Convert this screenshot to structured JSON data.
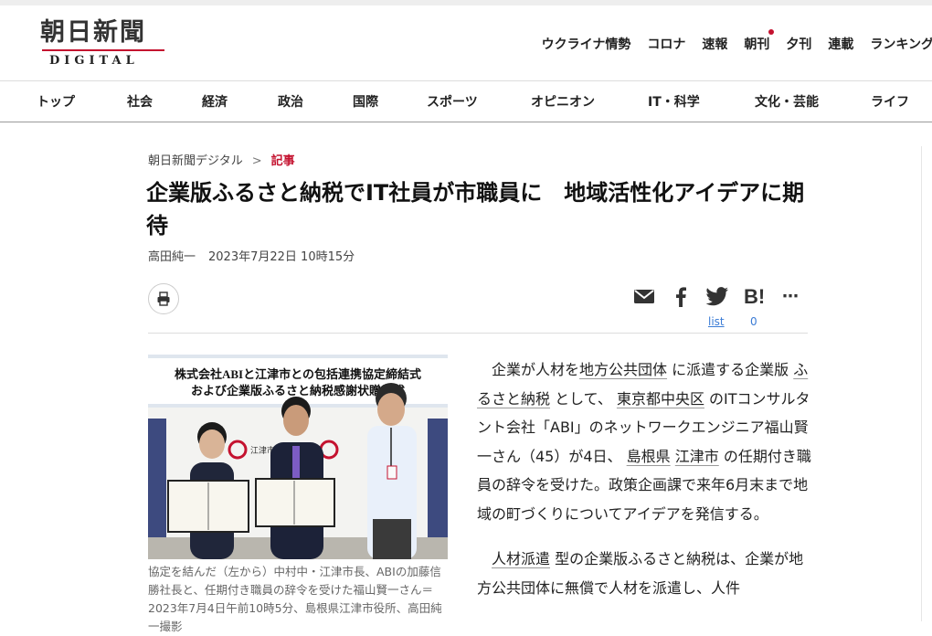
{
  "logo": {
    "title": "朝日新聞",
    "sub": "DIGITAL"
  },
  "util_nav": [
    "ウクライナ情勢",
    "コロナ",
    "速報",
    "朝刊",
    "夕刊",
    "連載",
    "ランキング"
  ],
  "main_nav": [
    "トップ",
    "社会",
    "経済",
    "政治",
    "国際",
    "スポーツ",
    "オピニオン",
    "IT・科学",
    "文化・芸能",
    "ライフ"
  ],
  "breadcrumb": {
    "home": "朝日新聞デジタル",
    "sep": ">",
    "current": "記事"
  },
  "article": {
    "title": "企業版ふるさと納税でIT社員が市職員に　地域活性化アイデアに期待",
    "author": "高田純一",
    "date": "2023年7月22日 10時15分"
  },
  "share": {
    "list_label": "list",
    "hatena_count": "0",
    "hatena_label": "B!"
  },
  "photo": {
    "banner_line1": "株式会社ABIと江津市との包括連携協定締結式",
    "banner_line2": "および企業版ふるさと納税感謝状贈呈式",
    "backdrop_text": "江津市"
  },
  "caption": "協定を結んだ（左から）中村中・江津市長、ABIの加藤信勝社長と、任期付き職員の辞令を受けた福山賢一さん＝2023年7月4日午前10時5分、島根県江津市役所、高田純一撮影",
  "body": {
    "p1": {
      "a": "企業が人材を",
      "link1": "地方公共団体",
      "b": "に派遣する企業版",
      "link2": "ふるさと納税",
      "c": "として、",
      "link3": "東京都中央区",
      "d": "のITコンサルタント会社「ABI」のネットワークエンジニア福山賢一さん（45）が4日、",
      "link4": "島根県",
      "link5": "江津市",
      "e": "の任期付き職員の辞令を受けた。政策企画課で来年6月末まで地域の町づくりについてアイデアを発信する。"
    },
    "p2": {
      "link1": "人材派遣",
      "a": "型の企業版ふるさと納税は、企業が地方公共団体に無償で人材を派遣し、人件"
    }
  },
  "colors": {
    "accent": "#c4122f",
    "link": "#3a7bd5"
  }
}
